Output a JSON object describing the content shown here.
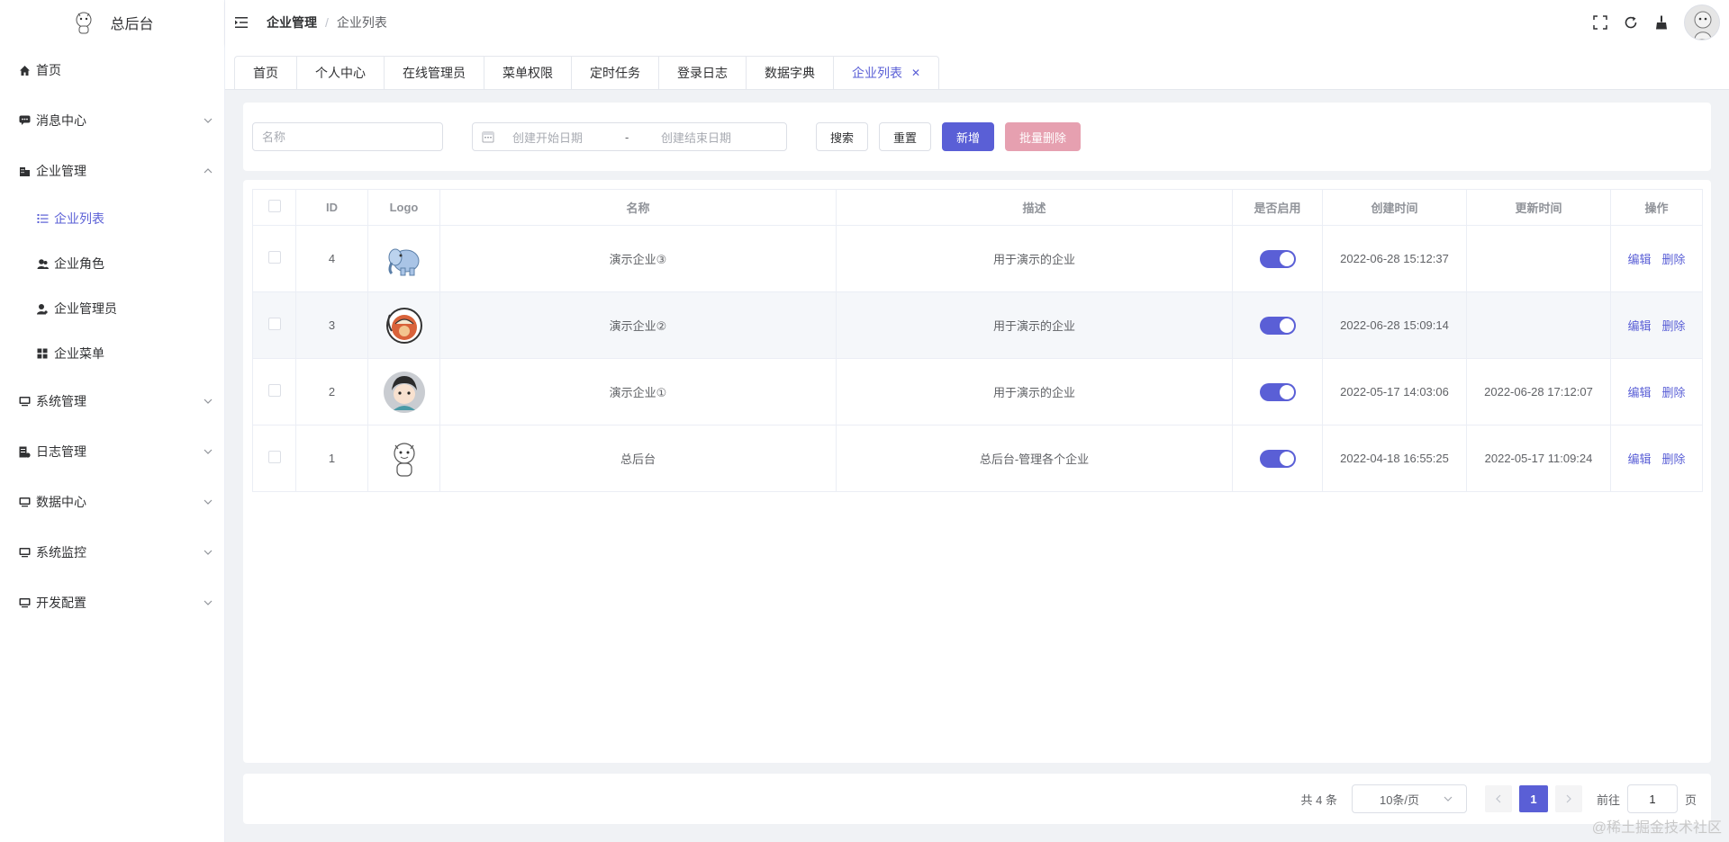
{
  "app": {
    "title": "总后台"
  },
  "sidebar": {
    "items": [
      {
        "label": "首页",
        "icon": "home-icon"
      },
      {
        "label": "消息中心",
        "icon": "message-icon"
      },
      {
        "label": "企业管理",
        "icon": "company-icon"
      },
      {
        "label": "系统管理",
        "icon": "monitor-icon"
      },
      {
        "label": "日志管理",
        "icon": "log-icon"
      },
      {
        "label": "数据中心",
        "icon": "monitor-icon"
      },
      {
        "label": "系统监控",
        "icon": "monitor-icon"
      },
      {
        "label": "开发配置",
        "icon": "monitor-icon"
      }
    ],
    "sub_items": [
      {
        "label": "企业列表",
        "icon": "list-icon"
      },
      {
        "label": "企业角色",
        "icon": "role-icon"
      },
      {
        "label": "企业管理员",
        "icon": "user-icon"
      },
      {
        "label": "企业菜单",
        "icon": "grid-icon"
      }
    ]
  },
  "header": {
    "breadcrumb": [
      "企业管理",
      "企业列表"
    ],
    "separator": "/"
  },
  "tabs": [
    "首页",
    "个人中心",
    "在线管理员",
    "菜单权限",
    "定时任务",
    "登录日志",
    "数据字典",
    "企业列表"
  ],
  "search": {
    "name_placeholder": "名称",
    "start_placeholder": "创建开始日期",
    "range_sep": "-",
    "end_placeholder": "创建结束日期",
    "search_btn": "搜索",
    "reset_btn": "重置",
    "add_btn": "新增",
    "batch_delete_btn": "批量删除"
  },
  "table": {
    "columns": [
      "ID",
      "Logo",
      "名称",
      "描述",
      "是否启用",
      "创建时间",
      "更新时间",
      "操作"
    ],
    "rows": [
      {
        "id": "4",
        "name": "演示企业③",
        "desc": "用于演示的企业",
        "enabled": true,
        "created": "2022-06-28 15:12:37",
        "updated": "",
        "logo": "elephant-logo"
      },
      {
        "id": "3",
        "name": "演示企业②",
        "desc": "用于演示的企业",
        "enabled": true,
        "created": "2022-06-28 15:09:14",
        "updated": "",
        "logo": "astronaut-logo"
      },
      {
        "id": "2",
        "name": "演示企业①",
        "desc": "用于演示的企业",
        "enabled": true,
        "created": "2022-05-17 14:03:06",
        "updated": "2022-06-28 17:12:07",
        "logo": "boy-avatar-logo"
      },
      {
        "id": "1",
        "name": "总后台",
        "desc": "总后台-管理各个企业",
        "enabled": true,
        "created": "2022-04-18 16:55:25",
        "updated": "2022-05-17 11:09:24",
        "logo": "tiger-logo"
      }
    ],
    "edit_label": "编辑",
    "delete_label": "删除"
  },
  "pagination": {
    "total_text": "共 4 条",
    "page_size": "10条/页",
    "current_page": "1",
    "goto_label": "前往",
    "goto_value": "1",
    "page_unit": "页"
  },
  "watermark": "@稀土掘金技术社区",
  "colors": {
    "primary": "#5a5fd6",
    "danger_light": "#e6a0b0"
  }
}
